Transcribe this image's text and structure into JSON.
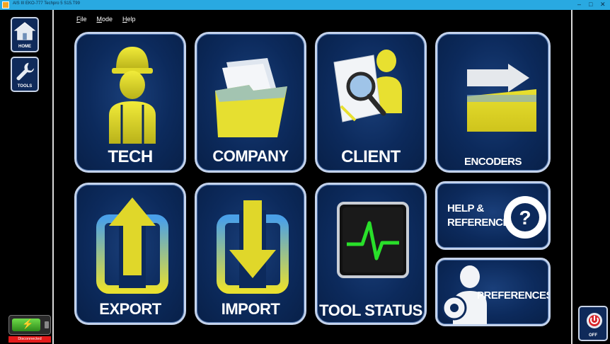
{
  "window": {
    "title": "AIS III EKO-777 Techpro 5 S15.T99",
    "controls": [
      "–",
      "□",
      "✕"
    ]
  },
  "menu": [
    "File",
    "Mode",
    "Help"
  ],
  "sidebar": {
    "home_label": "HOME",
    "tools_label": "TOOLS"
  },
  "status": {
    "connection": "Disconnected",
    "battery_icon": "battery-charging-icon"
  },
  "tiles": {
    "tech": "TECH",
    "company": "COMPANY",
    "client": "CLIENT",
    "encoders": "ENCODERS",
    "export": "EXPORT",
    "import": "IMPORT",
    "tool_status": "TOOL STATUS",
    "help_line1": "HELP &",
    "help_line2": "REFERENCE",
    "preferences": "PREFERENCES"
  },
  "power": {
    "label": "OFF"
  },
  "colors": {
    "tile_bg": "#0c2a5c",
    "tile_border": "#c4d3ec",
    "accent_yellow": "#e8e030",
    "titlebar": "#29a9e1",
    "status_red": "#e41b1b"
  }
}
